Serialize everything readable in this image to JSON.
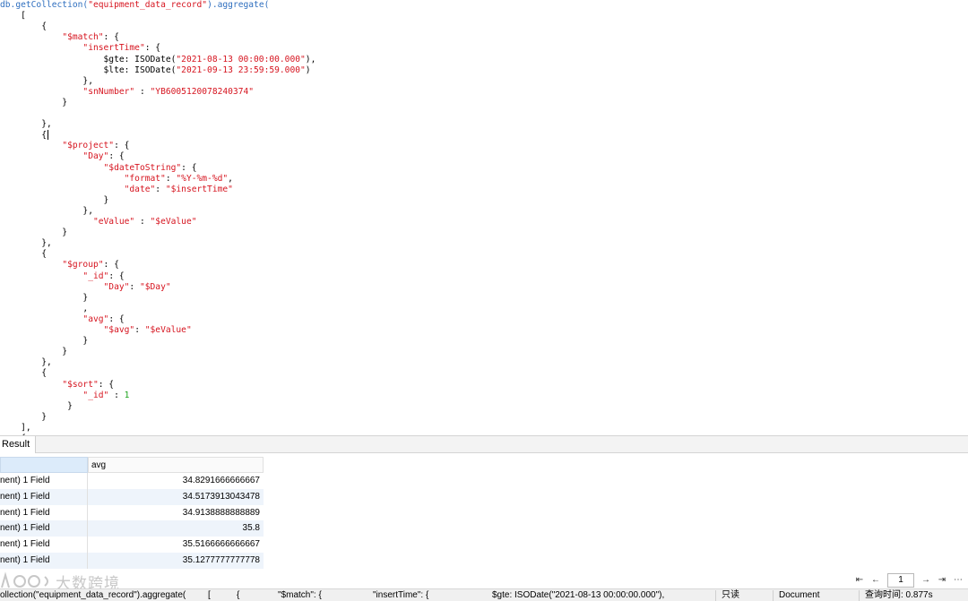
{
  "editor": {
    "lines": [
      [
        {
          "t": "db.getCollection(",
          "c": "m"
        },
        {
          "t": "\"equipment_data_record\"",
          "c": "s"
        },
        {
          "t": ").aggregate(",
          "c": "m"
        }
      ],
      [
        {
          "t": "    [",
          "c": "p"
        }
      ],
      [
        {
          "t": "        {",
          "c": "p"
        }
      ],
      [
        {
          "t": "            ",
          "c": "p"
        },
        {
          "t": "\"$match\"",
          "c": "k"
        },
        {
          "t": ": {",
          "c": "p"
        }
      ],
      [
        {
          "t": "                ",
          "c": "p"
        },
        {
          "t": "\"insertTime\"",
          "c": "k"
        },
        {
          "t": ": {",
          "c": "p"
        }
      ],
      [
        {
          "t": "                    $gte: ISODate(",
          "c": "p"
        },
        {
          "t": "\"2021-08-13 00:00:00.000\"",
          "c": "s"
        },
        {
          "t": "),",
          "c": "p"
        }
      ],
      [
        {
          "t": "                    $lte: ISODate(",
          "c": "p"
        },
        {
          "t": "\"2021-09-13 23:59:59.000\"",
          "c": "s"
        },
        {
          "t": ")",
          "c": "p"
        }
      ],
      [
        {
          "t": "                },",
          "c": "p"
        }
      ],
      [
        {
          "t": "                ",
          "c": "p"
        },
        {
          "t": "\"snNumber\"",
          "c": "k"
        },
        {
          "t": " : ",
          "c": "p"
        },
        {
          "t": "\"YB6005120078240374\"",
          "c": "s"
        }
      ],
      [
        {
          "t": "            }",
          "c": "p"
        }
      ],
      [
        {
          "t": "",
          "c": "p"
        }
      ],
      [
        {
          "t": "        },",
          "c": "p"
        }
      ],
      [
        {
          "t": "        {",
          "c": "p"
        },
        {
          "t": "",
          "c": "cursor"
        }
      ],
      [
        {
          "t": "            ",
          "c": "p"
        },
        {
          "t": "\"$project\"",
          "c": "k"
        },
        {
          "t": ": {",
          "c": "p"
        }
      ],
      [
        {
          "t": "                ",
          "c": "p"
        },
        {
          "t": "\"Day\"",
          "c": "k"
        },
        {
          "t": ": {",
          "c": "p"
        }
      ],
      [
        {
          "t": "                    ",
          "c": "p"
        },
        {
          "t": "\"$dateToString\"",
          "c": "k"
        },
        {
          "t": ": {",
          "c": "p"
        }
      ],
      [
        {
          "t": "                        ",
          "c": "p"
        },
        {
          "t": "\"format\"",
          "c": "k"
        },
        {
          "t": ": ",
          "c": "p"
        },
        {
          "t": "\"%Y-%m-%d\"",
          "c": "s"
        },
        {
          "t": ",",
          "c": "p"
        }
      ],
      [
        {
          "t": "                        ",
          "c": "p"
        },
        {
          "t": "\"date\"",
          "c": "k"
        },
        {
          "t": ": ",
          "c": "p"
        },
        {
          "t": "\"$insertTime\"",
          "c": "s"
        }
      ],
      [
        {
          "t": "                    }",
          "c": "p"
        }
      ],
      [
        {
          "t": "                },",
          "c": "p"
        }
      ],
      [
        {
          "t": "                  ",
          "c": "p"
        },
        {
          "t": "\"eValue\"",
          "c": "k"
        },
        {
          "t": " : ",
          "c": "p"
        },
        {
          "t": "\"$eValue\"",
          "c": "s"
        }
      ],
      [
        {
          "t": "            }",
          "c": "p"
        }
      ],
      [
        {
          "t": "        },",
          "c": "p"
        }
      ],
      [
        {
          "t": "        {",
          "c": "p"
        }
      ],
      [
        {
          "t": "            ",
          "c": "p"
        },
        {
          "t": "\"$group\"",
          "c": "k"
        },
        {
          "t": ": {",
          "c": "p"
        }
      ],
      [
        {
          "t": "                ",
          "c": "p"
        },
        {
          "t": "\"_id\"",
          "c": "k"
        },
        {
          "t": ": {",
          "c": "p"
        }
      ],
      [
        {
          "t": "                    ",
          "c": "p"
        },
        {
          "t": "\"Day\"",
          "c": "k"
        },
        {
          "t": ": ",
          "c": "p"
        },
        {
          "t": "\"$Day\"",
          "c": "s"
        }
      ],
      [
        {
          "t": "                }",
          "c": "p"
        }
      ],
      [
        {
          "t": "                ,",
          "c": "p"
        }
      ],
      [
        {
          "t": "                ",
          "c": "p"
        },
        {
          "t": "\"avg\"",
          "c": "k"
        },
        {
          "t": ": {",
          "c": "p"
        }
      ],
      [
        {
          "t": "                    ",
          "c": "p"
        },
        {
          "t": "\"$avg\"",
          "c": "k"
        },
        {
          "t": ": ",
          "c": "p"
        },
        {
          "t": "\"$eValue\"",
          "c": "s"
        }
      ],
      [
        {
          "t": "                }",
          "c": "p"
        }
      ],
      [
        {
          "t": "            }",
          "c": "p"
        }
      ],
      [
        {
          "t": "        },",
          "c": "p"
        }
      ],
      [
        {
          "t": "        {",
          "c": "p"
        }
      ],
      [
        {
          "t": "            ",
          "c": "p"
        },
        {
          "t": "\"$sort\"",
          "c": "k"
        },
        {
          "t": ": {",
          "c": "p"
        }
      ],
      [
        {
          "t": "                ",
          "c": "p"
        },
        {
          "t": "\"_id\"",
          "c": "k"
        },
        {
          "t": " : ",
          "c": "p"
        },
        {
          "t": "1",
          "c": "n"
        }
      ],
      [
        {
          "t": "             }",
          "c": "p"
        }
      ],
      [
        {
          "t": "        }",
          "c": "p"
        }
      ],
      [
        {
          "t": "    ],",
          "c": "p"
        }
      ],
      [
        {
          "t": "    {",
          "c": "p"
        }
      ]
    ]
  },
  "result_tab": {
    "label": "Result"
  },
  "grid": {
    "columns": [
      "",
      "avg"
    ],
    "rows": [
      {
        "doc": "nent) 1 Field",
        "avg": "34.8291666666667"
      },
      {
        "doc": "nent) 1 Field",
        "avg": "34.5173913043478"
      },
      {
        "doc": "nent) 1 Field",
        "avg": "34.9138888888889"
      },
      {
        "doc": "nent) 1 Field",
        "avg": "35.8"
      },
      {
        "doc": "nent) 1 Field",
        "avg": "35.5166666666667"
      },
      {
        "doc": "nent) 1 Field",
        "avg": "35.1277777777778"
      }
    ]
  },
  "watermark": {
    "text": "大数跨境"
  },
  "pager": {
    "first": "⇤",
    "prev": "←",
    "page": "1",
    "next": "→",
    "last": "⇥",
    "more": "⋯"
  },
  "status_bar": {
    "query": "ollection(\"equipment_data_record\").aggregate(",
    "bracket": "[",
    "brace": "{",
    "match": "\"$match\": {",
    "insert_time": "\"insertTime\": {",
    "gte": "$gte: ISODate(\"2021-08-13 00:00:00.000\"),",
    "mode": "只读",
    "view": "Document",
    "time": "查询时间: 0.877s"
  }
}
